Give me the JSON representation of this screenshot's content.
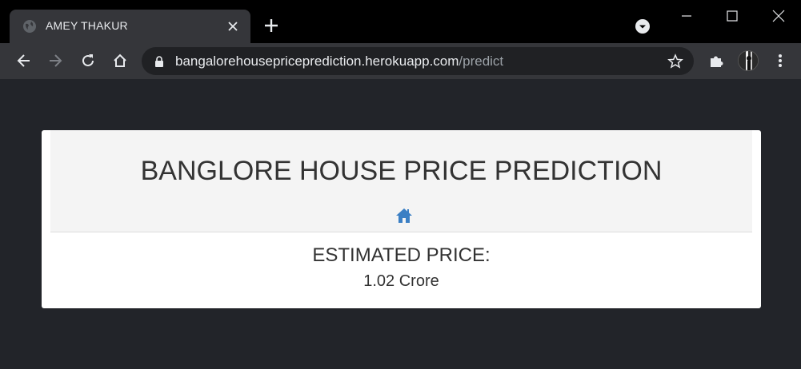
{
  "browser": {
    "tab": {
      "title": "AMEY THAKUR",
      "favicon": "globe-icon"
    },
    "address": {
      "host": "bangalorehousepriceprediction.herokuapp.com",
      "path": "/predict"
    }
  },
  "page": {
    "title": "BANGLORE HOUSE PRICE PREDICTION",
    "home_icon": "home-icon",
    "estimate_label": "ESTIMATED PRICE:",
    "estimate_value": "1.02 Crore"
  },
  "colors": {
    "page_background": "#222429",
    "card_header": "#f4f4f4",
    "home_icon": "#3a7fc4",
    "text": "#333333"
  }
}
